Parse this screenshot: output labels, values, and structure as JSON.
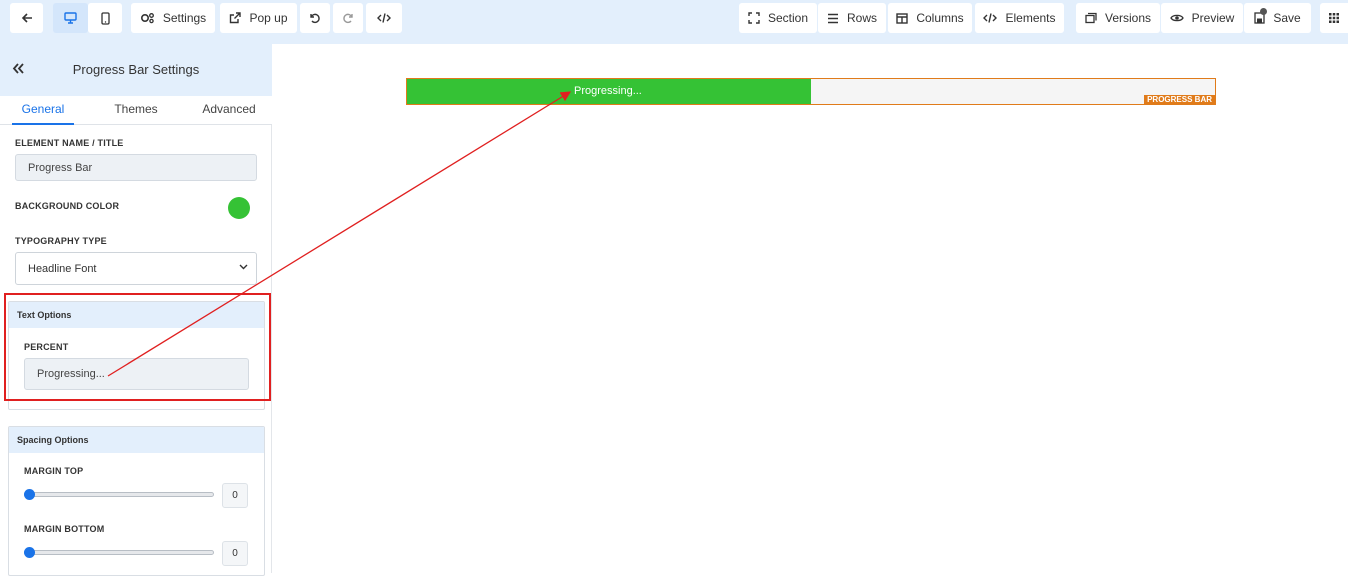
{
  "colors": {
    "toolbar_bg": "#e3effc",
    "accent": "#1a73e8",
    "progress_fill": "#35c235",
    "element_outline": "#e07b1a",
    "annotation_red": "#e02020"
  },
  "toolbar": {
    "back_icon": "arrow-left-icon",
    "desktop_icon": "desktop-icon",
    "mobile_icon": "mobile-icon",
    "settings_label": "Settings",
    "popup_label": "Pop up",
    "undo_icon": "undo-icon",
    "redo_icon": "redo-icon",
    "code_icon": "code-icon",
    "section_label": "Section",
    "rows_label": "Rows",
    "columns_label": "Columns",
    "elements_label": "Elements",
    "versions_label": "Versions",
    "preview_label": "Preview",
    "save_label": "Save",
    "grid_icon": "grid-icon"
  },
  "sidebar": {
    "title": "Progress Bar Settings",
    "tabs": [
      {
        "label": "General",
        "active": true
      },
      {
        "label": "Themes",
        "active": false
      },
      {
        "label": "Advanced",
        "active": false
      }
    ],
    "element_name_label": "ELEMENT NAME / TITLE",
    "element_name_value": "Progress Bar",
    "background_color_label": "BACKGROUND COLOR",
    "background_color_value": "#35c235",
    "typography_label": "TYPOGRAPHY TYPE",
    "typography_value": "Headline Font",
    "text_options": {
      "title": "Text Options",
      "percent_label": "PERCENT",
      "percent_value": "Progressing..."
    },
    "spacing_options": {
      "title": "Spacing Options",
      "margin_top_label": "MARGIN TOP",
      "margin_top_value": "0",
      "margin_bottom_label": "MARGIN BOTTOM",
      "margin_bottom_value": "0"
    }
  },
  "canvas": {
    "progress_text": "Progressing...",
    "progress_fraction": 0.5,
    "element_tag": "PROGRESS BAR"
  }
}
